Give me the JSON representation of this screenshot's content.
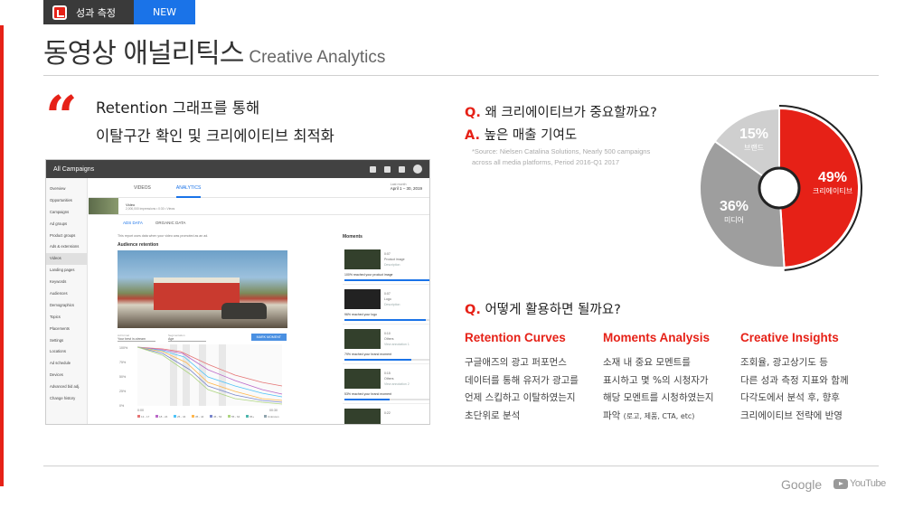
{
  "tag": {
    "label": "성과 측정",
    "badge": "NEW"
  },
  "title": {
    "main": "동영상 애널리틱스",
    "sub": "Creative Analytics"
  },
  "headline": {
    "line1": "Retention 그래프를 통해",
    "line2": "이탈구간 확인 및 크리에이티브 최적화"
  },
  "mock": {
    "app_title": "All Campaigns",
    "sidebar": [
      "Overview",
      "Opportunities",
      "Campaigns",
      "Ad groups",
      "Product groups",
      "Ads & extensions",
      "Videos",
      "Landing pages",
      "Keywords",
      "Audiences",
      "Demographics",
      "Topics",
      "Placements",
      "Settings",
      "Locations",
      "Ad schedule",
      "Devices",
      "Advanced bid adj.",
      "Change history"
    ],
    "active_sidebar": "Videos",
    "tabs": [
      "VIDEOS",
      "ANALYTICS"
    ],
    "date_label": "Last month",
    "date_range": "April 1 – 30, 2019",
    "video_title": "Video",
    "video_meta": "2,000,000 impressions  •  0:30  •  Views",
    "subtabs": [
      "ADS DATA",
      "ORGANIC DATA"
    ],
    "note": "This report uses data when your video was promoted as an ad.",
    "panel_title": "Audience retention",
    "control_left_label": "Ad format",
    "control_left_value": "Your best in-stream",
    "control_right_label": "Segmentation",
    "control_right_value": "Age",
    "mark_button": "MARK MOMENT",
    "y_ticks": [
      "100%",
      "75%",
      "50%",
      "25%",
      "0%"
    ],
    "x_ticks": [
      "0:00",
      "00:30"
    ],
    "legend": [
      "13 - 17",
      "18 - 24",
      "25 - 34",
      "35 - 44",
      "45 - 54",
      "55 - 64",
      "65+",
      "Unknown"
    ],
    "moments_title": "Moments",
    "moments": [
      {
        "time": "0:07",
        "tag": "Product image",
        "desc": "Description",
        "reach": "100% reached your product image",
        "pct": 100
      },
      {
        "time": "0:07",
        "tag": "Logo",
        "desc": "Description",
        "reach": "96% reached your logo",
        "pct": 96
      },
      {
        "time": "0:10",
        "tag": "Others",
        "desc": "View annotation 1",
        "reach": "79% reached your brand moment",
        "pct": 79
      },
      {
        "time": "0:15",
        "tag": "Others",
        "desc": "View annotation 2",
        "reach": "53% reached your brand moment",
        "pct": 53
      },
      {
        "time": "0:22",
        "tag": "",
        "desc": "",
        "reach": "",
        "pct": 0
      }
    ]
  },
  "q1": {
    "label": "Q.",
    "text": "왜 크리에이티브가 중요할까요?"
  },
  "a1": {
    "label": "A.",
    "text": "높은 매출 기여도"
  },
  "source": {
    "line1": "*Source: Nielsen Catalina Solutions, Nearly 500 campaigns",
    "line2": "across all media platforms, Period 2016-Q1 2017"
  },
  "chart_data": {
    "type": "pie",
    "slices": [
      {
        "label": "크리에이티브",
        "value": 49,
        "color": "#e62117"
      },
      {
        "label": "미디어",
        "value": 36,
        "color": "#9e9e9e"
      },
      {
        "label": "브랜드",
        "value": 15,
        "color": "#cfcfcf"
      }
    ],
    "percent_labels": [
      "49%",
      "36%",
      "15%"
    ]
  },
  "q2": {
    "label": "Q.",
    "text": "어떻게 활용하면 될까요?"
  },
  "columns": [
    {
      "title": "Retention Curves",
      "lines": [
        "구글애즈의 광고 퍼포먼스",
        "데이터를 통해 유저가 광고를",
        "언제 스킵하고 이탈하였는지",
        "초단위로 분석"
      ]
    },
    {
      "title": "Moments Analysis",
      "lines": [
        "소재 내 중요 모멘트를",
        "표시하고 몇 %의 시청자가",
        "해당 모멘트를 시청하였는지"
      ],
      "last_main": "파악",
      "last_small": "(로고, 제품, CTA, etc)"
    },
    {
      "title": "Creative Insights",
      "lines": [
        "조회율, 광고상기도 등",
        "다른 성과 측정 지표와 함께",
        "다각도에서 분석 후, 향후",
        "크리에이티브 전략에 반영"
      ]
    }
  ],
  "footer": {
    "google": "Google",
    "youtube": "YouTube"
  }
}
